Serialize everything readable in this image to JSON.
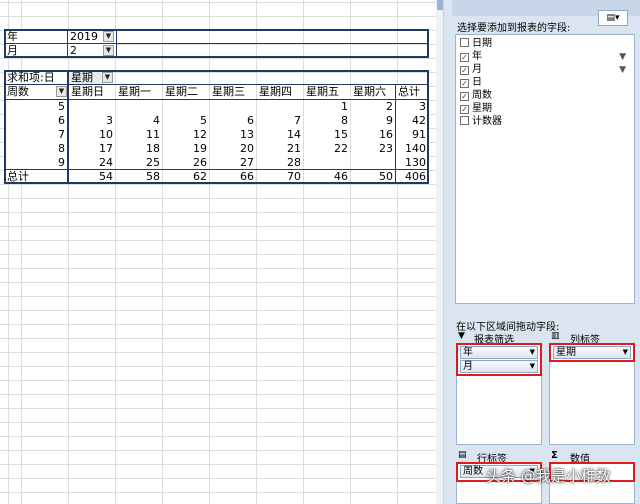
{
  "filters": [
    {
      "label": "年",
      "value": "2019"
    },
    {
      "label": "月",
      "value": "2"
    }
  ],
  "pivot": {
    "measure_label": "求和项:日",
    "col_field": "星期",
    "row_field": "周数",
    "headers": [
      "星期日",
      "星期一",
      "星期二",
      "星期三",
      "星期四",
      "星期五",
      "星期六",
      "总计"
    ],
    "rows": [
      {
        "label": "5",
        "values": [
          "",
          "",
          "",
          "",
          "",
          "1",
          "2",
          "3"
        ]
      },
      {
        "label": "6",
        "values": [
          "3",
          "4",
          "5",
          "6",
          "7",
          "8",
          "9",
          "42"
        ]
      },
      {
        "label": "7",
        "values": [
          "10",
          "11",
          "12",
          "13",
          "14",
          "15",
          "16",
          "91"
        ]
      },
      {
        "label": "8",
        "values": [
          "17",
          "18",
          "19",
          "20",
          "21",
          "22",
          "23",
          "140"
        ]
      },
      {
        "label": "9",
        "values": [
          "24",
          "25",
          "26",
          "27",
          "28",
          "",
          "",
          "130"
        ]
      }
    ],
    "total": {
      "label": "总计",
      "values": [
        "54",
        "58",
        "62",
        "66",
        "70",
        "46",
        "50",
        "406"
      ]
    }
  },
  "panel": {
    "choose_label": "选择要添加到报表的字段:",
    "fields": [
      {
        "name": "日期",
        "checked": false,
        "filtered": false
      },
      {
        "name": "年",
        "checked": true,
        "filtered": true
      },
      {
        "name": "月",
        "checked": true,
        "filtered": true
      },
      {
        "name": "日",
        "checked": true,
        "filtered": false
      },
      {
        "name": "周数",
        "checked": true,
        "filtered": false
      },
      {
        "name": "星期",
        "checked": true,
        "filtered": false
      },
      {
        "name": "计数器",
        "checked": false,
        "filtered": false
      }
    ],
    "drag_label": "在以下区域间拖动字段:",
    "report_filter_label": "报表筛选",
    "column_label_label": "列标签",
    "row_label_label": "行标签",
    "values_label": "数值",
    "report_filter_items": [
      "年",
      "月"
    ],
    "column_items": [
      "星期"
    ],
    "row_items": [
      "周数"
    ]
  },
  "watermark": "头条 @我是小稚数"
}
